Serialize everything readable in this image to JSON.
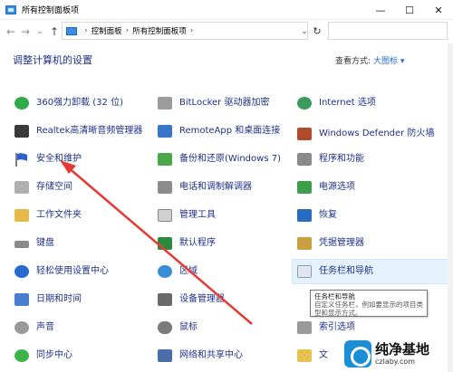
{
  "window": {
    "title": "所有控制面板项",
    "minimize": "—",
    "maximize": "☐",
    "close": "✕"
  },
  "nav": {
    "back": "←",
    "forward": "→",
    "down": "⌄",
    "up": "↑",
    "breadcrumb": [
      "控制面板",
      "所有控制面板项"
    ],
    "dropdown": "⌄",
    "refresh": "↻",
    "search_placeholder": ""
  },
  "header": {
    "title": "调整计算机的设置",
    "view_by_label": "查看方式:",
    "view_by_value": "大图标 ▾"
  },
  "items": {
    "col1": [
      "360强力卸载 (32 位)",
      "Realtek高清晰音频管理器",
      "安全和维护",
      "存储空间",
      "工作文件夹",
      "键盘",
      "轻松使用设置中心",
      "日期和时间",
      "声音",
      "同步中心"
    ],
    "col2": [
      "BitLocker 驱动器加密",
      "RemoteApp 和桌面连接",
      "备份和还原(Windows 7)",
      "电话和调制解调器",
      "管理工具",
      "默认程序",
      "区域",
      "设备管理器",
      "鼠标",
      "网络和共享中心"
    ],
    "col3": [
      "Internet 选项",
      "Windows Defender 防火墙",
      "程序和功能",
      "电源选项",
      "恢复",
      "凭据管理器",
      "任务栏和导航",
      "",
      "索引选项",
      "文"
    ]
  },
  "tooltip": {
    "title": "任务栏和导航",
    "body": "自定义任务栏，例如要显示的项目类型和显示方式。"
  },
  "watermark": {
    "main": "纯净基地",
    "sub": "czlaby.com"
  },
  "colors": {
    "link": "#1e3287",
    "arrow": "#e53935",
    "highlight": "#e5f1fb"
  }
}
